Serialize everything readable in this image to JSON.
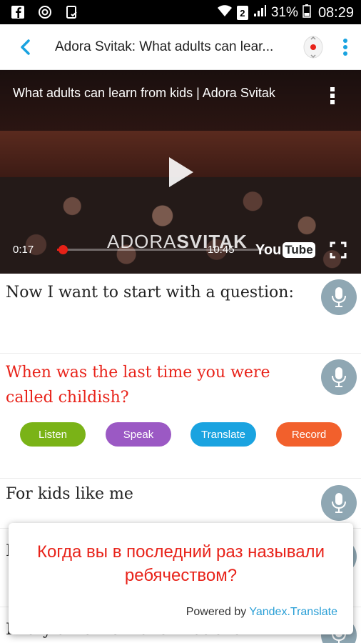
{
  "status_bar": {
    "battery": "31%",
    "time": "08:29",
    "sim_label": "2"
  },
  "app_bar": {
    "title": "Adora Svitak: What adults can lear..."
  },
  "video": {
    "title": "What adults can learn from kids | Adora Svitak",
    "overlay_name_light": "ADORA",
    "overlay_name_bold": "SVITAK",
    "current_time": "0:17",
    "total_time": "10:45",
    "progress_fraction": 0.027,
    "logo_you": "You",
    "logo_tube": "Tube"
  },
  "transcript": {
    "lines": [
      {
        "text": "Now I want to start with a question:"
      },
      {
        "text": "When was the last time you were called childish?"
      },
      {
        "text": "For kids like me"
      },
      {
        "text": "I"
      },
      {
        "text": "Every time we make irrational"
      }
    ],
    "actions": {
      "listen": "Listen",
      "speak": "Speak",
      "translate": "Translate",
      "record": "Record"
    }
  },
  "translation_popup": {
    "text": "Когда вы в последний раз называли ребячеством?",
    "powered_by": "Powered by",
    "provider": "Yandex.Translate"
  },
  "colors": {
    "accent_blue": "#2a9fd6",
    "active_red": "#e8231a",
    "listen": "#7ab317",
    "speak": "#9b59c4",
    "translate": "#1aa3e0",
    "record": "#f2602c",
    "mic": "#8fa7b3"
  }
}
